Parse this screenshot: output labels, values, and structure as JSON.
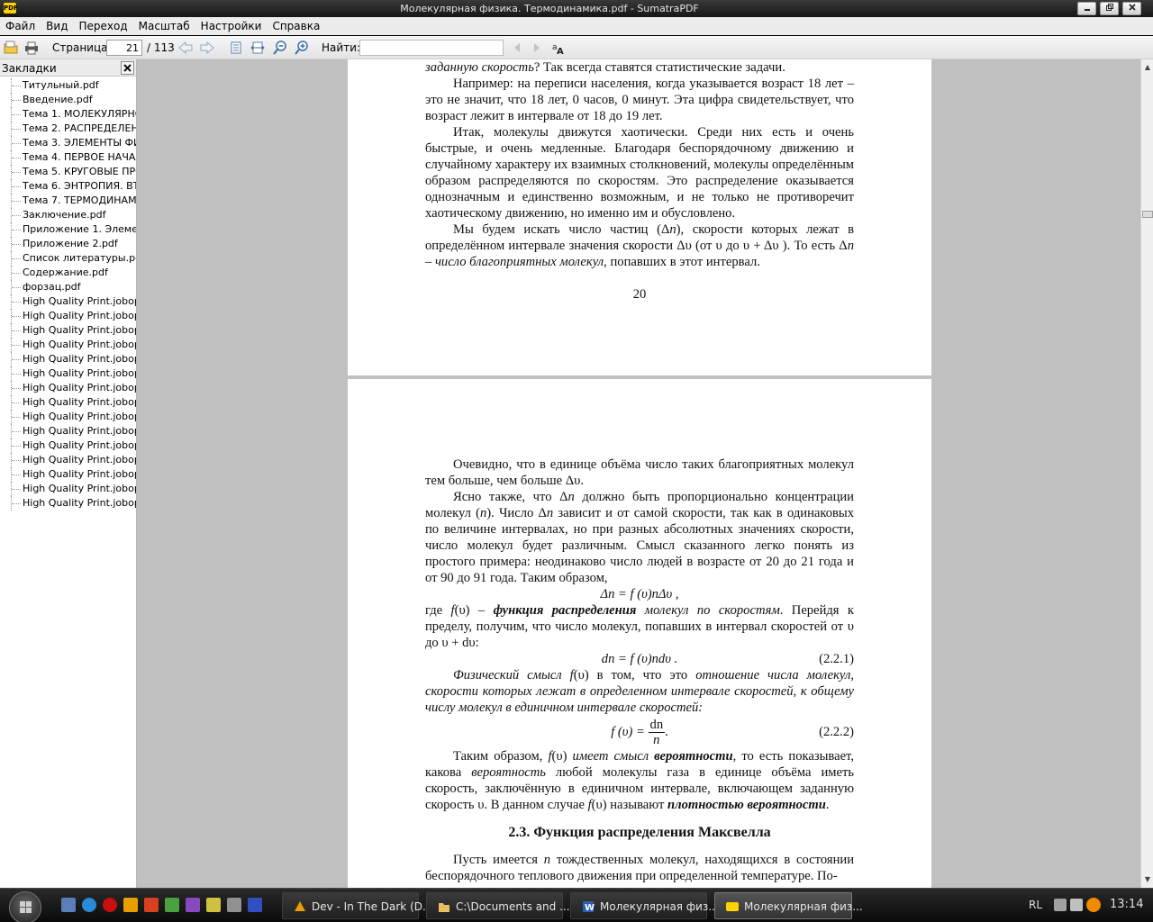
{
  "window": {
    "title": "Молекулярная физика. Термодинамика.pdf - SumatraPDF",
    "app_icon_text": "PDF"
  },
  "menu": [
    "Файл",
    "Вид",
    "Переход",
    "Масштаб",
    "Настройки",
    "Справка"
  ],
  "toolbar": {
    "page_label": "Страница:",
    "page_current": "21",
    "page_total": "/ 113",
    "find_label": "Найти:",
    "find_value": ""
  },
  "sidebar": {
    "title": "Закладки",
    "items": [
      "Титульный.pdf",
      "Введение.pdf",
      "Тема 1. МОЛЕКУЛЯРНО-",
      "Тема 2. РАСПРЕДЕЛЕНИ",
      "Тема 3. ЭЛЕМЕНТЫ ФИЗИ",
      "Тема 4. ПЕРВОЕ НАЧАЛО",
      "Тема 5.  КРУГОВЫЕ ПРО",
      "Тема 6. ЭНТРОПИЯ. ВТО",
      "Тема 7. ТЕРМОДИНАМИ",
      "Заключение.pdf",
      "Приложение 1. Элемен",
      "Приложение 2.pdf",
      "Список литературы.pdf",
      "Содержание.pdf",
      "форзац.pdf",
      "High Quality Print.jobop",
      "High Quality Print.jobop",
      "High Quality Print.jobop",
      "High Quality Print.jobop",
      "High Quality Print.jobop",
      "High Quality Print.jobop",
      "High Quality Print.jobop",
      "High Quality Print.jobop",
      "High Quality Print.jobop",
      "High Quality Print.jobop",
      "High Quality Print.jobop",
      "High Quality Print.jobop",
      "High Quality Print.jobop",
      "High Quality Print.jobop",
      "High Quality Print.jobop"
    ]
  },
  "doc": {
    "page1": {
      "line1_italic": "заданную скорость",
      "line1_rest": "? Так всегда ставятся статистические задачи.",
      "para2": "Например: на переписи населения, когда указывается возраст 18 лет – это не значит, что 18 лет, 0 часов, 0 минут. Эта цифра свидетельствует, что возраст лежит в интервале от 18 до 19 лет.",
      "para3": "Итак, молекулы движутся хаотически. Среди них есть и очень быстрые, и очень медленные. Благодаря беспорядочному движению и случайному характеру их взаимных столкновений, молекулы определённым образом распределяются по скоростям. Это распределение оказывается однозначным и единственно возможным, и не только не противоречит хаотическому движению, но именно им и обусловлено.",
      "para4_a": "Мы будем искать число частиц (Δ",
      "para4_n1": "n",
      "para4_b": "), скорости которых лежат в определённом интервале значения скорости Δυ (от υ до  υ + Δυ ). То есть Δ",
      "para4_n2": "n",
      "para4_c_italic": " – число благоприятных молекул",
      "para4_d": ", попавших в этот интервал.",
      "page_number": "20"
    },
    "page2": {
      "para1": "Очевидно, что в единице объёма число таких благоприятных молекул тем больше, чем больше Δυ.",
      "para2_a": "Ясно также, что Δ",
      "para2_n": "n",
      "para2_b": " должно быть пропорционально концентрации молекул (",
      "para2_n2": "n",
      "para2_c": "). Число Δ",
      "para2_n3": "n",
      "para2_d": " зависит и от самой скорости, так как в одинаковых по величине интервалах, но при разных абсолютных значениях скорости, число молекул будет различным. Смысл сказанного легко понять из простого примера: неодинаково число людей в возрасте от 20 до 21 года и от 90 до 91 года. Таким образом,",
      "eq1": "Δn = f (υ)nΔυ ,",
      "para3_a": "где ",
      "para3_f": "f",
      "para3_b": "(υ) – ",
      "para3_bold": "функция распределения",
      "para3_it": " молекул по скоростям",
      "para3_c": ". Перейдя к пределу, получим, что число молекул, попавших в интервал скоростей от υ до  υ + dυ:",
      "eq2": "dn = f (υ)ndυ .",
      "eq2_num": "(2.2.1)",
      "para4_it1": "Физический смысл ",
      "para4_f": "f",
      "para4_a": "(υ) в том, что это ",
      "para4_it2": "отношение числа молекул, скорости которых лежат в определенном интервале скоростей, к общему числу молекул в единичном интервале скоростей:",
      "eq3_left": "f (υ) =",
      "eq3_top": "dn",
      "eq3_bot": "n",
      "eq3_dot": ".",
      "eq3_num": "(2.2.2)",
      "para5_a": "Таким образом, ",
      "para5_f": "f",
      "para5_b": "(υ) ",
      "para5_it1": "имеет смысл ",
      "para5_bi1": "вероятности",
      "para5_c": ", то есть показывает, какова ",
      "para5_it2": "вероятность",
      "para5_d": " любой молекулы газа в единице объёма иметь скорость, заключённую в единичном интервале, включающем заданную скорость υ. В данном случае ",
      "para5_f2": "f",
      "para5_e": "(υ) называют ",
      "para5_bi2": "плотностью вероятности",
      "para5_g": ".",
      "section_title": "2.3. Функция распределения Максвелла",
      "para6_a": "Пусть имеется ",
      "para6_n": "n",
      "para6_b": " тождественных молекул, находящихся в состоянии беспорядочного теплового движения при определенной температуре. По-"
    }
  },
  "taskbar": {
    "tasks": [
      {
        "label": "Dev - In The Dark (D...",
        "icon": "winamp-icon"
      },
      {
        "label": "C:\\Documents and ...",
        "icon": "folder-icon"
      },
      {
        "label": "Молекулярная физ...",
        "icon": "word-icon"
      },
      {
        "label": "Молекулярная физ...",
        "icon": "sumatra-icon"
      }
    ],
    "lang": "RL",
    "clock": "13:14"
  }
}
